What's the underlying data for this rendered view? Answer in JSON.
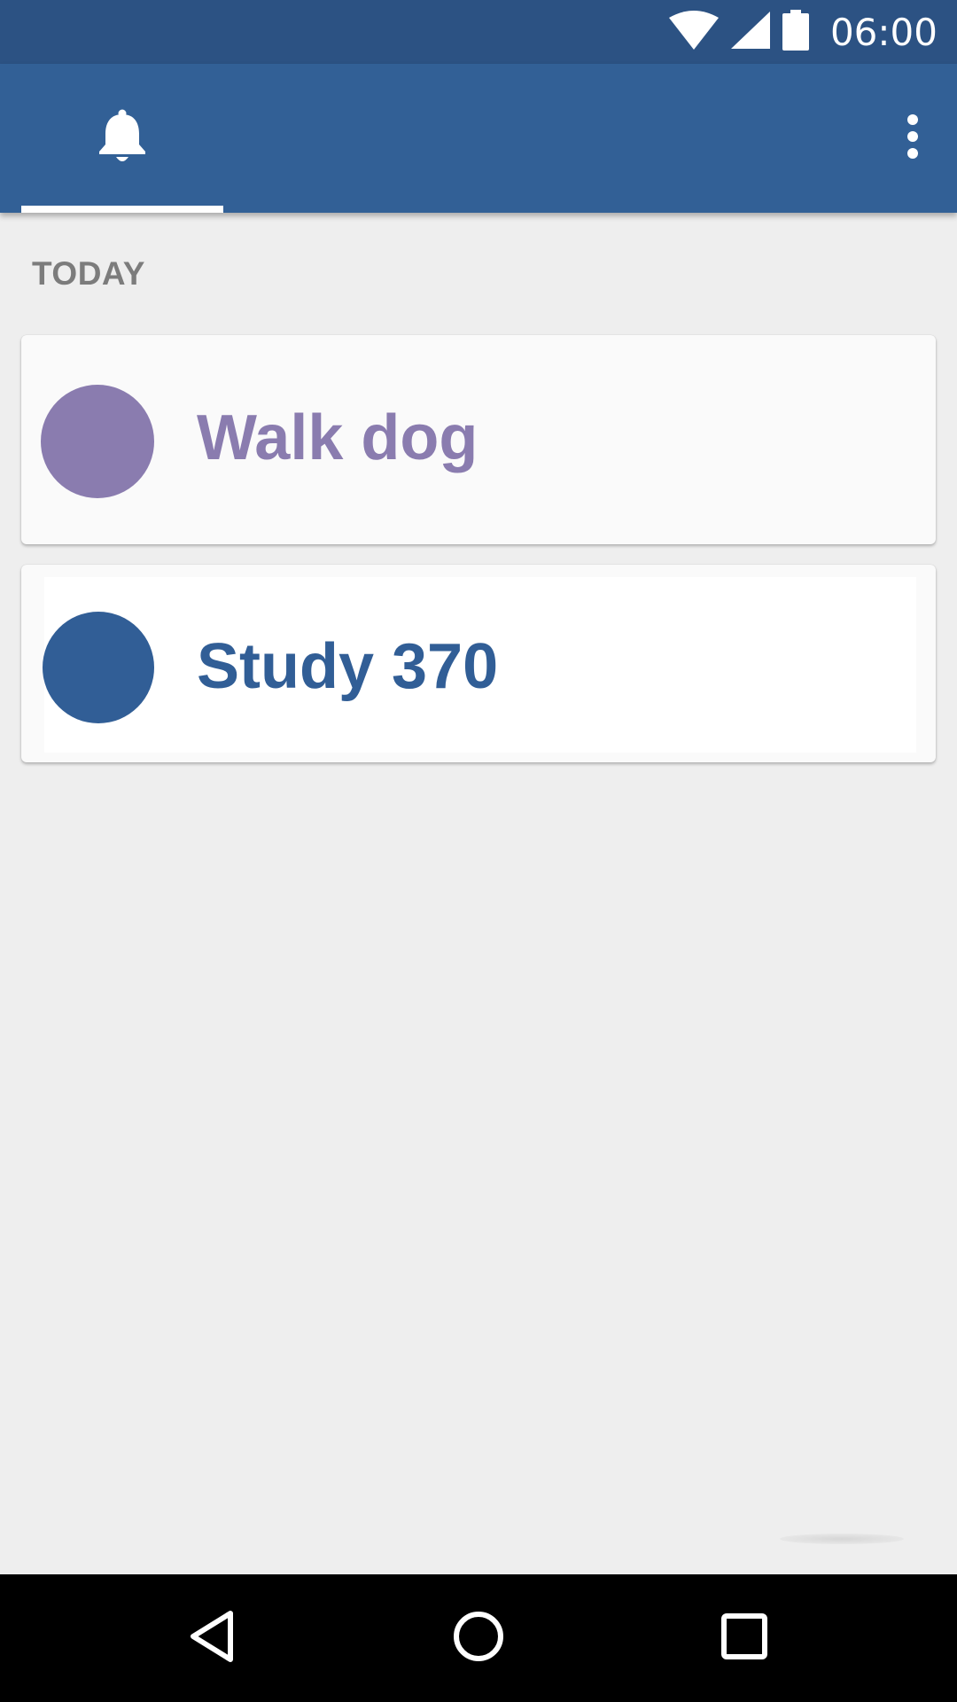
{
  "status_bar": {
    "time": "06:00",
    "icons": [
      "wifi-icon",
      "cell-signal-icon",
      "battery-icon"
    ]
  },
  "app_bar": {
    "tabs": [
      {
        "icon": "bell-icon",
        "selected": true
      }
    ],
    "overflow_icon": "more-vert-icon"
  },
  "content": {
    "section_header": "TODAY",
    "tasks": [
      {
        "label": "Walk dog",
        "color": "#8a7caf"
      },
      {
        "label": "Study 370",
        "color": "#315e96"
      }
    ]
  },
  "nav_bar": {
    "buttons": [
      "back-icon",
      "home-icon",
      "recents-icon"
    ]
  },
  "colors": {
    "status_bar": "#2c5283",
    "app_bar": "#326096",
    "background": "#eeeeee",
    "section_header": "#7c7c7c"
  }
}
